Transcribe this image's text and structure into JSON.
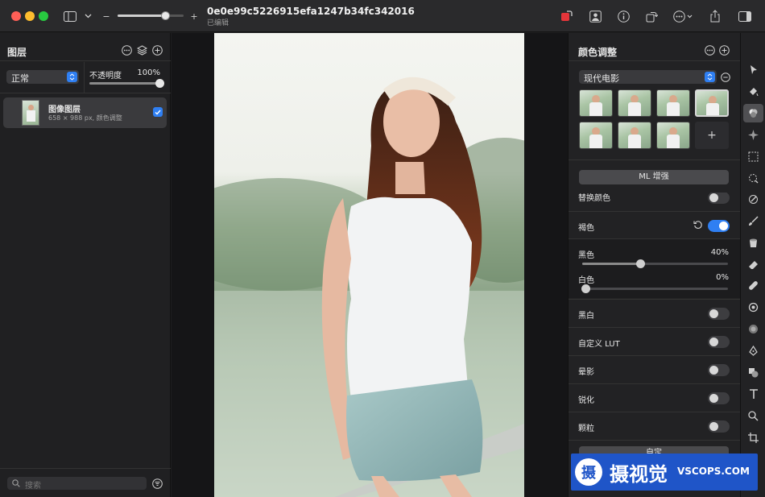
{
  "window": {
    "title": "0e0e99c5226915efa1247b34fc342016",
    "subtitle": "已编辑",
    "zoom_minus": "−",
    "zoom_plus": "+",
    "zoom_level": 0.72
  },
  "layers_panel": {
    "title": "图层",
    "blend_mode": "正常",
    "opacity_label": "不透明度",
    "opacity_value": "100%",
    "layer": {
      "name": "图像图层",
      "details": "658 × 988 px, 颜色调整",
      "checked": true
    },
    "search_placeholder": "搜索"
  },
  "adjust_panel": {
    "title": "颜色调整",
    "preset": "现代电影",
    "add_label": "+",
    "ml_button": "ML 增强",
    "replace_color_label": "替换颜色",
    "sepia": {
      "label": "褐色",
      "enabled": true,
      "black_label": "黑色",
      "black_value": "40%",
      "black_level": 0.4,
      "white_label": "白色",
      "white_value": "0%",
      "white_level": 0
    },
    "toggles": [
      {
        "label": "黑白",
        "on": false
      },
      {
        "label": "自定义 LUT",
        "on": false
      },
      {
        "label": "晕影",
        "on": false
      },
      {
        "label": "锐化",
        "on": false
      },
      {
        "label": "颗粒",
        "on": false
      }
    ],
    "bottom_button": "自定"
  },
  "watermark": {
    "brand": "摄视觉",
    "site": "VSCOPS.COM"
  },
  "colors": {
    "accent": "#2f7ff2",
    "close": "#fe5f57",
    "minimize": "#febc2e",
    "zoom": "#28c840"
  }
}
